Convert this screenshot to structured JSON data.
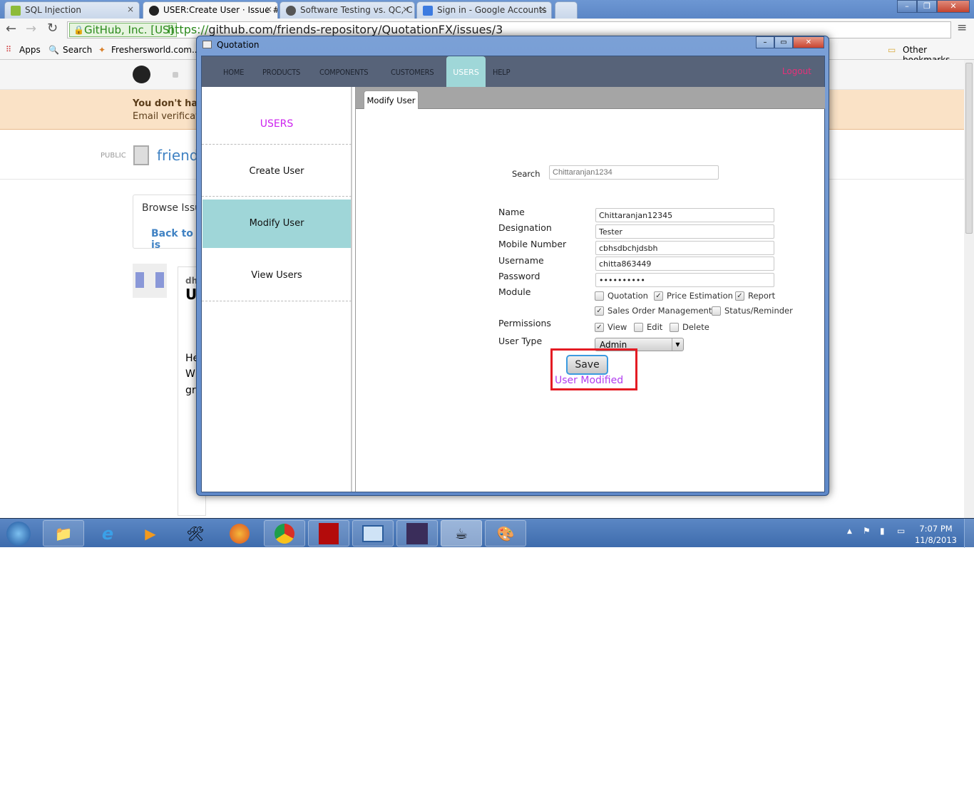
{
  "browser": {
    "tabs": [
      {
        "title": "SQL Injection",
        "color": "#8dbb3a",
        "active": false
      },
      {
        "title": "USER:Create User · Issue #",
        "color": "#222222",
        "active": true
      },
      {
        "title": "Software Testing vs. QC, C",
        "color": "#555555",
        "active": false
      },
      {
        "title": "Sign in - Google Accounts",
        "color": "#3c7be0",
        "active": false
      }
    ],
    "ev_label": "GitHub, Inc. [US]",
    "url_scheme": "https://",
    "url_rest": "github.com/friends-repository/QuotationFX/issues/3",
    "bookmarks": [
      "Apps",
      "Search",
      "Freshersworld.com..."
    ],
    "other_bookmarks": "Other bookmarks"
  },
  "github": {
    "banner_title": "You don't hav",
    "banner_sub": "Email verificatio",
    "public": "PUBLIC",
    "repo": "friends",
    "browse": "Browse Issu",
    "back": "Back to is",
    "author": "dh",
    "issue_initial": "U",
    "body_lines": [
      "He",
      "W",
      "gr"
    ]
  },
  "app": {
    "title": "Quotation",
    "nav": [
      "HOME",
      "PRODUCTS",
      "COMPONENTS",
      "CUSTOMERS",
      "USERS",
      "HELP"
    ],
    "active_nav": "USERS",
    "logout": "Logout",
    "sidebar": {
      "heading": "USERS",
      "items": [
        "Create User",
        "Modify User",
        "View Users"
      ],
      "selected": "Modify User"
    },
    "tab": "Modify User",
    "search": {
      "label": "Search",
      "placeholder": "Chittaranjan1234"
    },
    "fields": [
      {
        "label": "Name",
        "value": "Chittaranjan12345"
      },
      {
        "label": "Designation",
        "value": "Tester"
      },
      {
        "label": "Mobile Number",
        "value": "cbhsdbchjdsbh"
      },
      {
        "label": "Username",
        "value": "chitta863449"
      },
      {
        "label": "Password",
        "value": "••••••••••"
      }
    ],
    "module_label": "Module",
    "modules": [
      {
        "label": "Quotation",
        "checked": false
      },
      {
        "label": "Price Estimation",
        "checked": true
      },
      {
        "label": "Report",
        "checked": true
      },
      {
        "label": "Sales Order Management",
        "checked": true
      },
      {
        "label": "Status/Reminder",
        "checked": false
      }
    ],
    "permissions_label": "Permissions",
    "permissions": [
      {
        "label": "View",
        "checked": true
      },
      {
        "label": "Edit",
        "checked": false
      },
      {
        "label": "Delete",
        "checked": false
      }
    ],
    "user_type_label": "User Type",
    "user_type": "Admin",
    "save": "Save",
    "status": "User Modified",
    "colors": {
      "nav": "#576379",
      "active": "#9fd7d8",
      "status": "#b03cf0",
      "logout": "#e8307a",
      "highlight": "#e41b23"
    }
  },
  "taskbar": {
    "icons": [
      "start-orb",
      "file-explorer",
      "internet-explorer",
      "media-player",
      "tools",
      "firefox",
      "chrome",
      "acrobat",
      "remote-desktop",
      "java-ee-ide",
      "java",
      "paint"
    ],
    "time": "7:07 PM",
    "date": "11/8/2013"
  }
}
